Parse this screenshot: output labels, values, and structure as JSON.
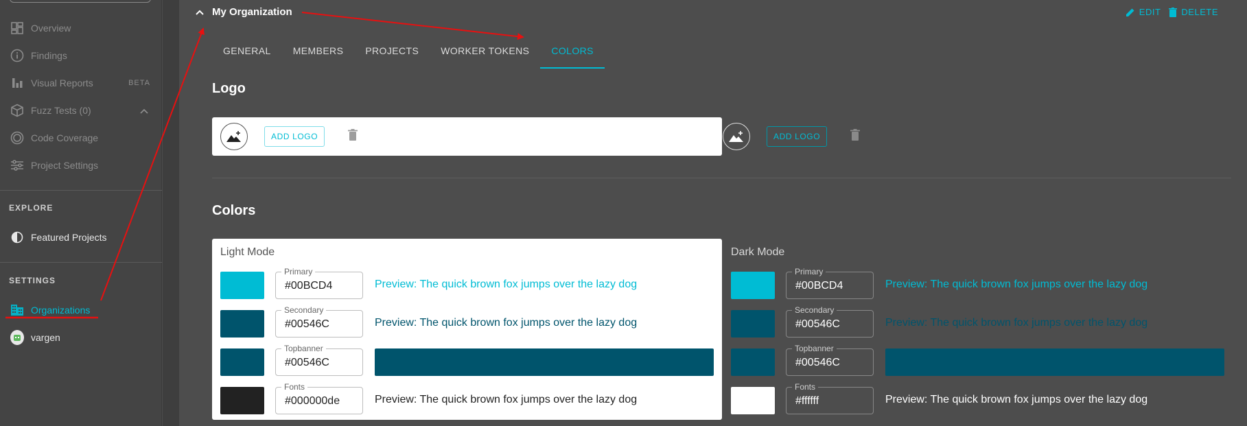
{
  "sidebar": {
    "items": [
      {
        "label": "Overview",
        "icon": "dashboard-icon"
      },
      {
        "label": "Findings",
        "icon": "info-icon"
      },
      {
        "label": "Visual Reports",
        "badge": "BETA",
        "icon": "bar-chart-icon"
      },
      {
        "label": "Fuzz Tests (0)",
        "icon": "package-icon"
      },
      {
        "label": "Code Coverage",
        "icon": "coverage-icon"
      },
      {
        "label": "Project Settings",
        "icon": "sliders-icon"
      }
    ],
    "explore_heading": "EXPLORE",
    "featured_label": "Featured Projects",
    "settings_heading": "SETTINGS",
    "organizations_label": "Organizations",
    "user_label": "vargen"
  },
  "header": {
    "org_name": "My Organization",
    "edit_label": "EDIT",
    "delete_label": "DELETE"
  },
  "tabs": [
    "GENERAL",
    "MEMBERS",
    "PROJECTS",
    "WORKER TOKENS",
    "COLORS"
  ],
  "active_tab": "COLORS",
  "logo_section": {
    "heading": "Logo",
    "add_logo_label": "ADD LOGO"
  },
  "colors_section": {
    "heading": "Colors",
    "light": {
      "title": "Light Mode",
      "rows": [
        {
          "label": "Primary",
          "value": "#00BCD4",
          "preview": "Preview: The quick brown fox jumps over the lazy dog"
        },
        {
          "label": "Secondary",
          "value": "#00546C",
          "preview": "Preview: The quick brown fox jumps over the lazy dog"
        },
        {
          "label": "Topbanner",
          "value": "#00546C"
        },
        {
          "label": "Fonts",
          "value": "#000000de",
          "preview": "Preview: The quick brown fox jumps over the lazy dog"
        }
      ]
    },
    "dark": {
      "title": "Dark Mode",
      "rows": [
        {
          "label": "Primary",
          "value": "#00BCD4",
          "preview": "Preview: The quick brown fox jumps over the lazy dog"
        },
        {
          "label": "Secondary",
          "value": "#00546C",
          "preview": "Preview: The quick brown fox jumps over the lazy dog"
        },
        {
          "label": "Topbanner",
          "value": "#00546C"
        },
        {
          "label": "Fonts",
          "value": "#ffffff",
          "preview": "Preview: The quick brown fox jumps over the lazy dog"
        }
      ]
    }
  },
  "colors": {
    "accent": "#00BCD4",
    "secondary": "#00546C",
    "annotation": "#e81010"
  }
}
